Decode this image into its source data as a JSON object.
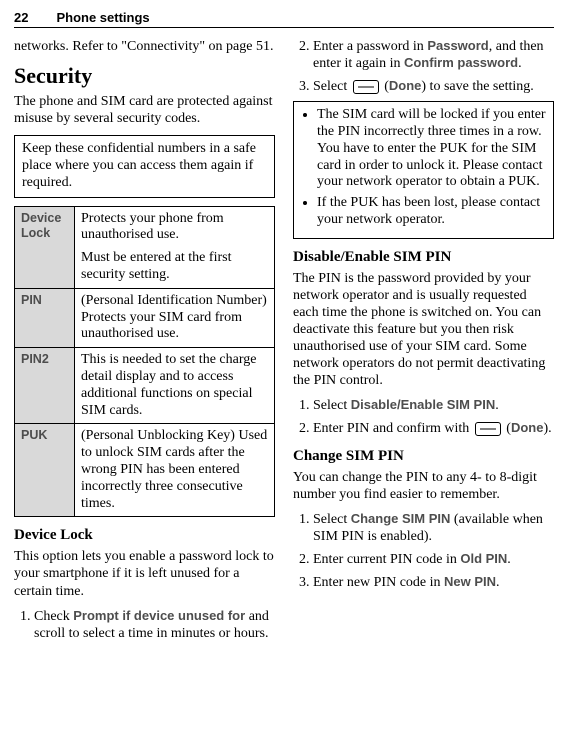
{
  "header": {
    "page_number": "22",
    "running_head": "Phone settings"
  },
  "left": {
    "para_top": "networks. Refer to \"Connectivity\" on page 51.",
    "h1": "Security",
    "para_intro": "The phone and SIM card are protected against misuse by several security codes.",
    "box_keep": "Keep these confidential numbers in a safe place where you can access them again if required.",
    "table": {
      "r1": {
        "label": "Device Lock",
        "text1": "Protects your phone from unauthorised use.",
        "text2": "Must be entered at the first security setting."
      },
      "r2": {
        "label": "PIN",
        "text": "(Personal Identification Number) Protects your SIM card from unauthorised use."
      },
      "r3": {
        "label": "PIN2",
        "text": "This is needed to set the charge detail display and to access additional functions on special SIM cards."
      },
      "r4": {
        "label": "PUK",
        "text": "(Personal Unblocking Key) Used to unlock SIM cards after the wrong PIN has been entered incorrectly three consecutive times."
      }
    },
    "h2_devicelock": "Device Lock",
    "para_devicelock": "This option lets you enable a password lock to your smartphone if it is left unused for a certain time.",
    "step1_a": "Check ",
    "step1_b": "Prompt if device unused for",
    "step1_c": " and scroll to select a time in minutes or hours."
  },
  "right": {
    "step2_a": "Enter a password in ",
    "step2_b": "Password",
    "step2_c": ", and then enter it again in ",
    "step2_d": "Confirm password",
    "step2_e": ".",
    "step3_a": "Select ",
    "step3_b": " (",
    "step3_c": "Done",
    "step3_d": ") to save the setting.",
    "bullets": {
      "b1": "The SIM card will be locked if you enter the PIN incorrectly three times in a row. You have to enter the PUK for the SIM card in order to unlock it. Please contact your network operator to obtain a PUK.",
      "b2": "If the PUK has been lost, please contact your network operator."
    },
    "h2_disable": "Disable/Enable SIM PIN",
    "para_disable": "The PIN is the password provided by your network operator and is usually requested each time the phone is switched on. You can deactivate this feature but you then risk unauthorised use of your SIM card. Some network operators do not permit deactivating the PIN control.",
    "disable_step1_a": "Select ",
    "disable_step1_b": "Disable/Enable SIM PIN",
    "disable_step1_c": ".",
    "disable_step2_a": "Enter PIN and confirm with ",
    "disable_step2_b": " (",
    "disable_step2_c": "Done",
    "disable_step2_d": ").",
    "h2_change": "Change SIM PIN",
    "para_change": "You can change the PIN to any 4- to 8-digit number you find easier to remember.",
    "change_step1_a": "Select ",
    "change_step1_b": "Change SIM PIN",
    "change_step1_c": " (available when SIM PIN is enabled).",
    "change_step2_a": "Enter current PIN code in ",
    "change_step2_b": "Old PIN",
    "change_step2_c": ".",
    "change_step3_a": "Enter new PIN code in ",
    "change_step3_b": "New PIN",
    "change_step3_c": "."
  }
}
